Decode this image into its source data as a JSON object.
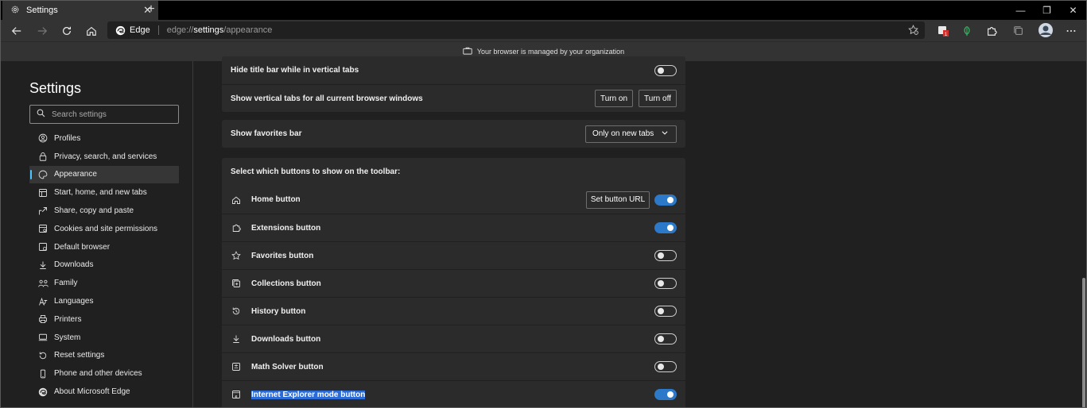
{
  "tab": {
    "title": "Settings",
    "close": "✕",
    "new_tab": "+"
  },
  "window_controls": {
    "minimize": "—",
    "restore": "❐",
    "close": "✕"
  },
  "address": {
    "brand": "Edge",
    "scheme": "edge://",
    "host": "settings",
    "path": "/appearance"
  },
  "infobar": {
    "text": "Your browser is managed by your organization"
  },
  "sidebar": {
    "title": "Settings",
    "search_placeholder": "Search settings",
    "items": [
      {
        "label": "Profiles",
        "icon": "profile-icon"
      },
      {
        "label": "Privacy, search, and services",
        "icon": "lock-icon"
      },
      {
        "label": "Appearance",
        "icon": "palette-icon",
        "active": true
      },
      {
        "label": "Start, home, and new tabs",
        "icon": "start-icon"
      },
      {
        "label": "Share, copy and paste",
        "icon": "share-icon"
      },
      {
        "label": "Cookies and site permissions",
        "icon": "cookie-icon"
      },
      {
        "label": "Default browser",
        "icon": "browser-icon"
      },
      {
        "label": "Downloads",
        "icon": "download-icon"
      },
      {
        "label": "Family",
        "icon": "family-icon"
      },
      {
        "label": "Languages",
        "icon": "language-icon"
      },
      {
        "label": "Printers",
        "icon": "printer-icon"
      },
      {
        "label": "System",
        "icon": "system-icon"
      },
      {
        "label": "Reset settings",
        "icon": "reset-icon"
      },
      {
        "label": "Phone and other devices",
        "icon": "phone-icon"
      },
      {
        "label": "About Microsoft Edge",
        "icon": "edge-icon"
      }
    ]
  },
  "vertical_tabs": {
    "hide_title_bar": "Hide title bar while in vertical tabs",
    "show_vertical_tabs": "Show vertical tabs for all current browser windows",
    "turn_on": "Turn on",
    "turn_off": "Turn off"
  },
  "favorites_bar": {
    "label": "Show favorites bar",
    "value": "Only on new tabs"
  },
  "toolbar_buttons": {
    "heading": "Select which buttons to show on the toolbar:",
    "set_button_url": "Set button URL",
    "items": [
      {
        "label": "Home button",
        "icon": "home-icon",
        "on": true
      },
      {
        "label": "Extensions button",
        "icon": "puzzle-icon",
        "on": true
      },
      {
        "label": "Favorites button",
        "icon": "star-icon",
        "on": false
      },
      {
        "label": "Collections button",
        "icon": "collections-icon",
        "on": false
      },
      {
        "label": "History button",
        "icon": "history-icon",
        "on": false
      },
      {
        "label": "Downloads button",
        "icon": "download-icon",
        "on": false
      },
      {
        "label": "Math Solver button",
        "icon": "math-icon",
        "on": false
      },
      {
        "label": "Internet Explorer mode button",
        "icon": "ie-mode-icon",
        "on": true,
        "selected": true
      }
    ]
  },
  "colors": {
    "accent": "#2c79c9",
    "active_indicator": "#4cc2ff",
    "background": "#202020",
    "card": "#2b2b2b"
  }
}
